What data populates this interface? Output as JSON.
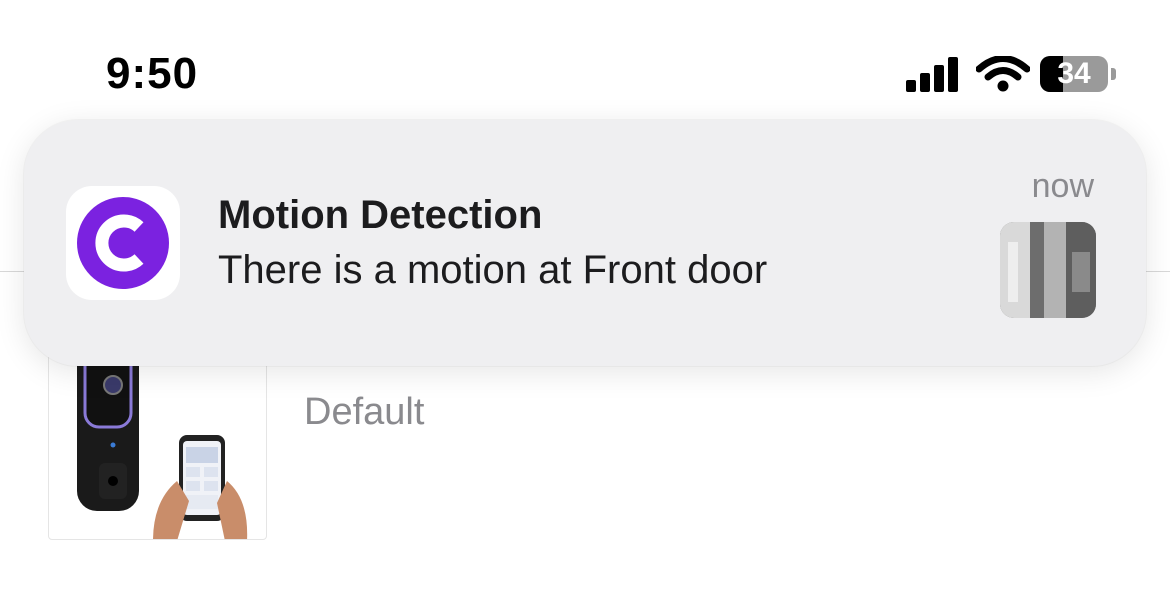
{
  "status_bar": {
    "time": "9:50",
    "battery": "34",
    "battery_level": 0.34,
    "signal_bars": 4,
    "icons": [
      "cellular-signal-icon",
      "wifi-icon",
      "battery-icon"
    ]
  },
  "notification": {
    "app_icon": "app-c-logo-icon",
    "accent_color": "#7b22e0",
    "title": "Motion Detection",
    "body": "There is a motion at Front door",
    "time": "now"
  },
  "device_list": {
    "items": [
      {
        "label": "Default",
        "meta": ", ."
      }
    ]
  }
}
